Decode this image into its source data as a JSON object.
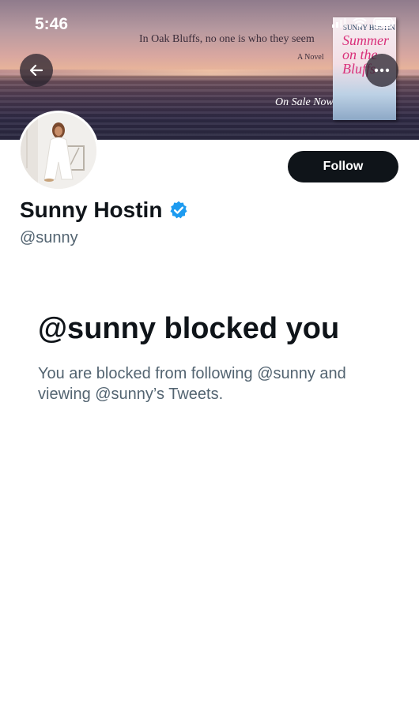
{
  "status_bar": {
    "time": "5:46"
  },
  "banner": {
    "tagline": "In Oak Bluffs, no one is who they seem",
    "novel_label": "A Novel",
    "on_sale": "On Sale Now",
    "book_author": "SUNNY HOSTIN",
    "book_title": "Summer on the Bluffs"
  },
  "header": {
    "back_icon": "arrow-left-icon",
    "more_icon": "ellipsis-icon"
  },
  "profile": {
    "display_name": "Sunny Hostin",
    "handle": "@sunny",
    "verified": true,
    "follow_label": "Follow"
  },
  "blocked": {
    "title": "@sunny blocked you",
    "description": "You are blocked from following @sunny and viewing @sunny’s Tweets."
  },
  "colors": {
    "primary_text": "#0f1419",
    "secondary_text": "#536471",
    "verified_blue": "#1d9bf0"
  }
}
